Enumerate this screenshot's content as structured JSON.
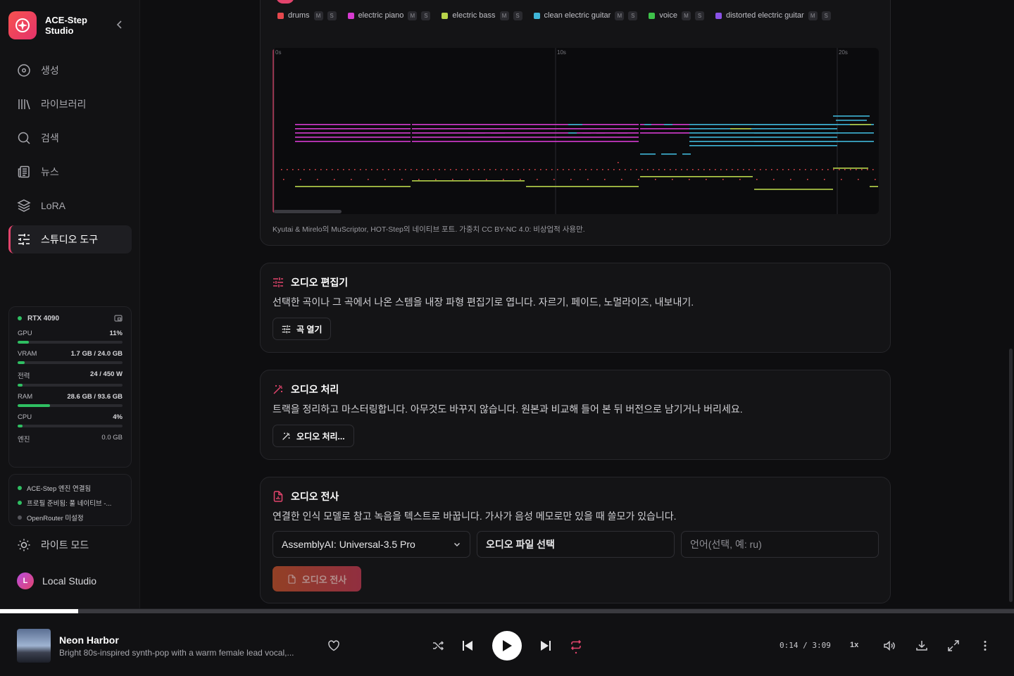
{
  "app": {
    "name_line1": "ACE-Step",
    "name_line2": "Studio"
  },
  "nav": [
    {
      "label": "생성",
      "icon": "disc-icon"
    },
    {
      "label": "라이브러리",
      "icon": "library-icon"
    },
    {
      "label": "검색",
      "icon": "search-icon"
    },
    {
      "label": "뉴스",
      "icon": "newspaper-icon"
    },
    {
      "label": "LoRA",
      "icon": "layers-icon"
    },
    {
      "label": "스튜디오 도구",
      "icon": "sliders-icon",
      "active": true
    }
  ],
  "gpu": {
    "name": "RTX 4090",
    "stats": [
      {
        "label": "GPU",
        "value": "11%",
        "fill": 0.11
      },
      {
        "label": "VRAM",
        "value": "1.7 GB / 24.0 GB",
        "fill": 0.07
      },
      {
        "label": "전력",
        "value": "24 / 450 W",
        "fill": 0.05
      },
      {
        "label": "RAM",
        "value": "28.6 GB / 93.6 GB",
        "fill": 0.31
      },
      {
        "label": "CPU",
        "value": "4%",
        "fill": 0.04
      }
    ],
    "engine_label": "엔진",
    "engine_value": "0.0 GB"
  },
  "status": {
    "line1": "ACE-Step 엔진 연결됨",
    "line2": "프로필 준비됨: 풀 네이티브 -...",
    "line3": "OpenRouter 미설정"
  },
  "light_mode": "라이트 모드",
  "user": {
    "initial": "L",
    "name": "Local Studio"
  },
  "midi": {
    "tracks": [
      {
        "name": "drums",
        "color": "#e5484d"
      },
      {
        "name": "electric piano",
        "color": "#d63bd0"
      },
      {
        "name": "electric bass",
        "color": "#b8d44a"
      },
      {
        "name": "clean electric guitar",
        "color": "#3fb6d8"
      },
      {
        "name": "voice",
        "color": "#3ec24a"
      },
      {
        "name": "distorted electric guitar",
        "color": "#8a52e6"
      }
    ],
    "mute_label": "M",
    "solo_label": "S",
    "time_labels": [
      "0s",
      "10s",
      "20s"
    ],
    "credit": "Kyutai & Mirelo의 MuScriptor, HOT-Step의 네이티브 포트. 가중치 CC BY-NC 4.0: 비상업적 사용만."
  },
  "editor": {
    "title": "오디오 편집기",
    "desc": "선택한 곡이나 그 곡에서 나온 스템을 내장 파형 편집기로 엽니다. 자르기, 페이드, 노멀라이즈, 내보내기.",
    "button": "곡 열기"
  },
  "process": {
    "title": "오디오 처리",
    "desc": "트랙을 정리하고 마스터링합니다. 아무것도 바꾸지 않습니다. 원본과 비교해 들어 본 뒤 버전으로 남기거나 버리세요.",
    "button": "오디오 처리..."
  },
  "transcribe": {
    "title": "오디오 전사",
    "desc": "연결한 인식 모델로 참고 녹음을 텍스트로 바꿉니다. 가사가 음성 메모로만 있을 때 쓸모가 있습니다.",
    "model": "AssemblyAI: Universal-3.5 Pro",
    "file_button": "오디오 파일 선택",
    "language_placeholder": "언어(선택, 예: ru)",
    "submit": "오디오 전사"
  },
  "player": {
    "title": "Neon Harbor",
    "subtitle": "Bright 80s-inspired synth-pop with a warm female lead vocal,...",
    "time": "0:14 / 3:09",
    "speed": "1x",
    "progress": 0.077
  }
}
